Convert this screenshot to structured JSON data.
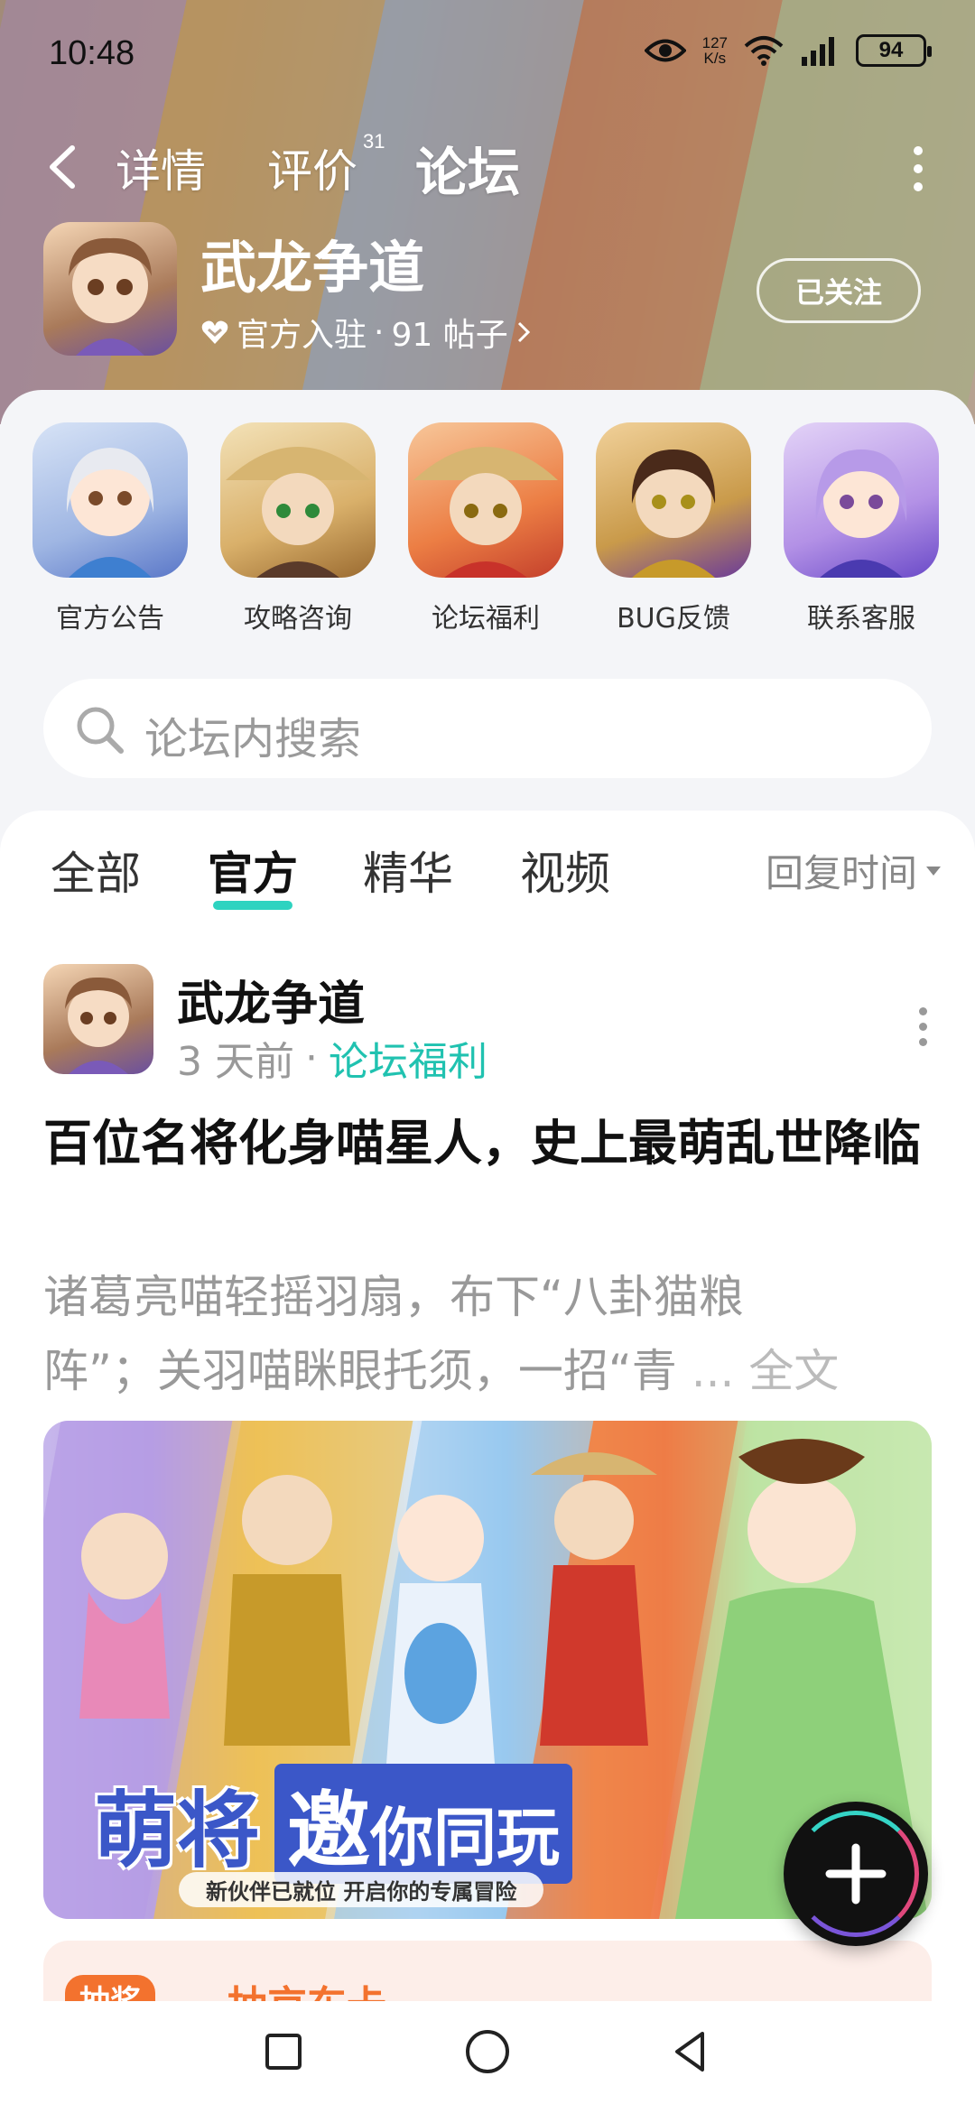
{
  "status_bar": {
    "time": "10:48",
    "net_speed_value": "127",
    "net_speed_unit": "K/s",
    "battery": "94"
  },
  "nav": {
    "tabs": [
      {
        "label": "详情"
      },
      {
        "label": "评价",
        "badge": "31"
      },
      {
        "label": "论坛",
        "active": true
      }
    ]
  },
  "game": {
    "title": "武龙争道",
    "official_label": "官方入驻",
    "post_count": "91 帖子",
    "follow_label": "已关注"
  },
  "quick_links": [
    {
      "label": "官方公告"
    },
    {
      "label": "攻略咨询"
    },
    {
      "label": "论坛福利"
    },
    {
      "label": "BUG反馈"
    },
    {
      "label": "联系客服"
    }
  ],
  "search": {
    "placeholder": "论坛内搜索"
  },
  "filter_tabs": [
    {
      "label": "全部"
    },
    {
      "label": "官方",
      "active": true
    },
    {
      "label": "精华"
    },
    {
      "label": "视频"
    }
  ],
  "sort_label": "回复时间",
  "post": {
    "author": "武龙争道",
    "time": "3 天前",
    "category": "论坛福利",
    "title": "百位名将化身喵星人，史上最萌乱世降临",
    "body_line1": "诸葛亮喵轻摇羽扇，布下“八卦猫粮",
    "body_line2": "阵”；关羽喵眯眼托须，一招“青",
    "ellipsis": "...",
    "fulltext_label": "全文",
    "banner_title_1": "萌将",
    "banner_title_2": "邀",
    "banner_title_3": "你同玩",
    "banner_subtitle": "新伙伴已就位 开启你的专属冒险"
  },
  "next_post": {
    "badge": "抽奖",
    "title": "抽京东卡"
  },
  "colors": {
    "accent": "#2ed3c0",
    "category": "#20c2b0",
    "orange": "#f3722e"
  }
}
